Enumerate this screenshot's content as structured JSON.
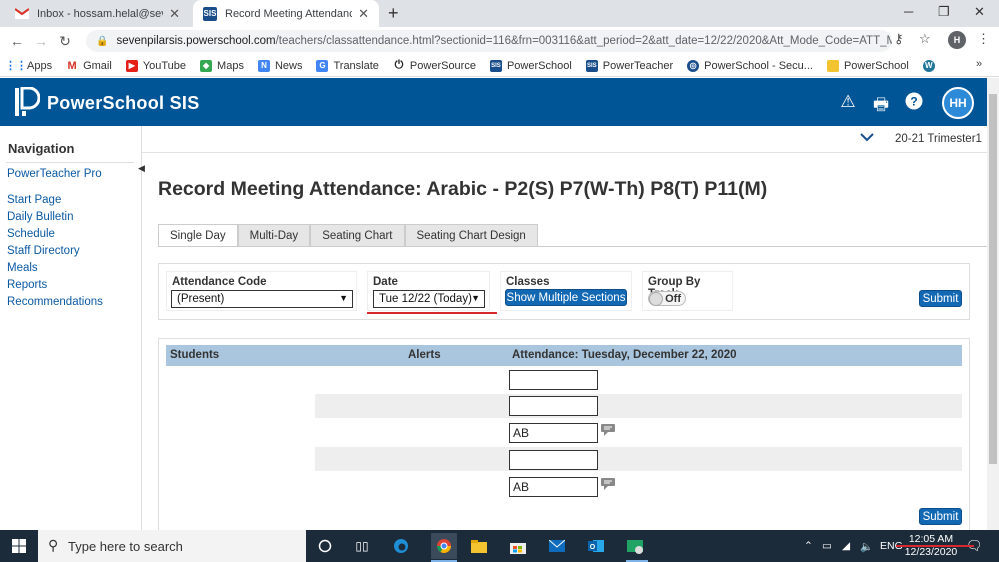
{
  "browser": {
    "tabs": [
      {
        "title": "Inbox - hossam.helal@sevenpill",
        "favicon": "gmail-icon",
        "active": false
      },
      {
        "title": "Record Meeting Attendance",
        "favicon": "sis-icon",
        "active": true
      }
    ],
    "new_tab": "+",
    "url_host": "sevenpilarsis.powerschool.com",
    "url_path": "/teachers/classattendance.html?sectionid=116&frn=003116&att_period=2&att_date=12/22/2020&Att_Mode_Code=ATT_Mode...",
    "profile_initial": "H",
    "bookmarks": [
      {
        "label": "Apps",
        "icon": "apps-grid-icon"
      },
      {
        "label": "Gmail",
        "icon": "gmail-icon"
      },
      {
        "label": "YouTube",
        "icon": "youtube-icon"
      },
      {
        "label": "Maps",
        "icon": "maps-icon"
      },
      {
        "label": "News",
        "icon": "news-icon"
      },
      {
        "label": "Translate",
        "icon": "translate-icon"
      },
      {
        "label": "PowerSource",
        "icon": "power-icon"
      },
      {
        "label": "PowerSchool",
        "icon": "sis-icon"
      },
      {
        "label": "PowerTeacher",
        "icon": "sis-icon"
      },
      {
        "label": "PowerSchool - Secu...",
        "icon": "globe-icon"
      },
      {
        "label": "PowerSchool",
        "icon": "folder-icon"
      }
    ]
  },
  "header": {
    "title": "PowerSchool SIS",
    "avatar_initials": "HH",
    "colors": {
      "bar": "#005596"
    }
  },
  "sidebar": {
    "heading": "Navigation",
    "items": [
      {
        "label": "PowerTeacher Pro"
      },
      {
        "label": "Start Page"
      },
      {
        "label": "Daily Bulletin"
      },
      {
        "label": "Schedule"
      },
      {
        "label": "Staff Directory"
      },
      {
        "label": "Meals"
      },
      {
        "label": "Reports"
      },
      {
        "label": "Recommendations"
      }
    ]
  },
  "term": "20-21 Trimester1",
  "page_title": "Record Meeting Attendance: Arabic - P2(S) P7(W-Th) P8(T) P11(M)",
  "tabs": [
    {
      "label": "Single Day",
      "active": true
    },
    {
      "label": "Multi-Day",
      "active": false
    },
    {
      "label": "Seating Chart",
      "active": false
    },
    {
      "label": "Seating Chart Design",
      "active": false
    }
  ],
  "controls": {
    "attendance_code_label": "Attendance Code",
    "attendance_code_value": "(Present)",
    "date_label": "Date",
    "date_value": "Tue 12/22 (Today)",
    "classes_label": "Classes",
    "show_multiple_sections": "Show Multiple Sections",
    "group_by_track_label": "Group By Track",
    "toggle_state": "Off",
    "submit": "Submit"
  },
  "table": {
    "headers": {
      "students": "Students",
      "alerts": "Alerts",
      "attendance": "Attendance: Tuesday, December 22, 2020"
    },
    "rows": [
      {
        "value": "",
        "comment": false
      },
      {
        "value": "",
        "comment": false
      },
      {
        "value": "AB",
        "comment": true
      },
      {
        "value": "",
        "comment": false
      },
      {
        "value": "AB",
        "comment": true
      }
    ],
    "submit": "Submit"
  },
  "taskbar": {
    "search_placeholder": "Type here to search",
    "language": "ENG",
    "time": "12:05 AM",
    "date": "12/23/2020"
  }
}
